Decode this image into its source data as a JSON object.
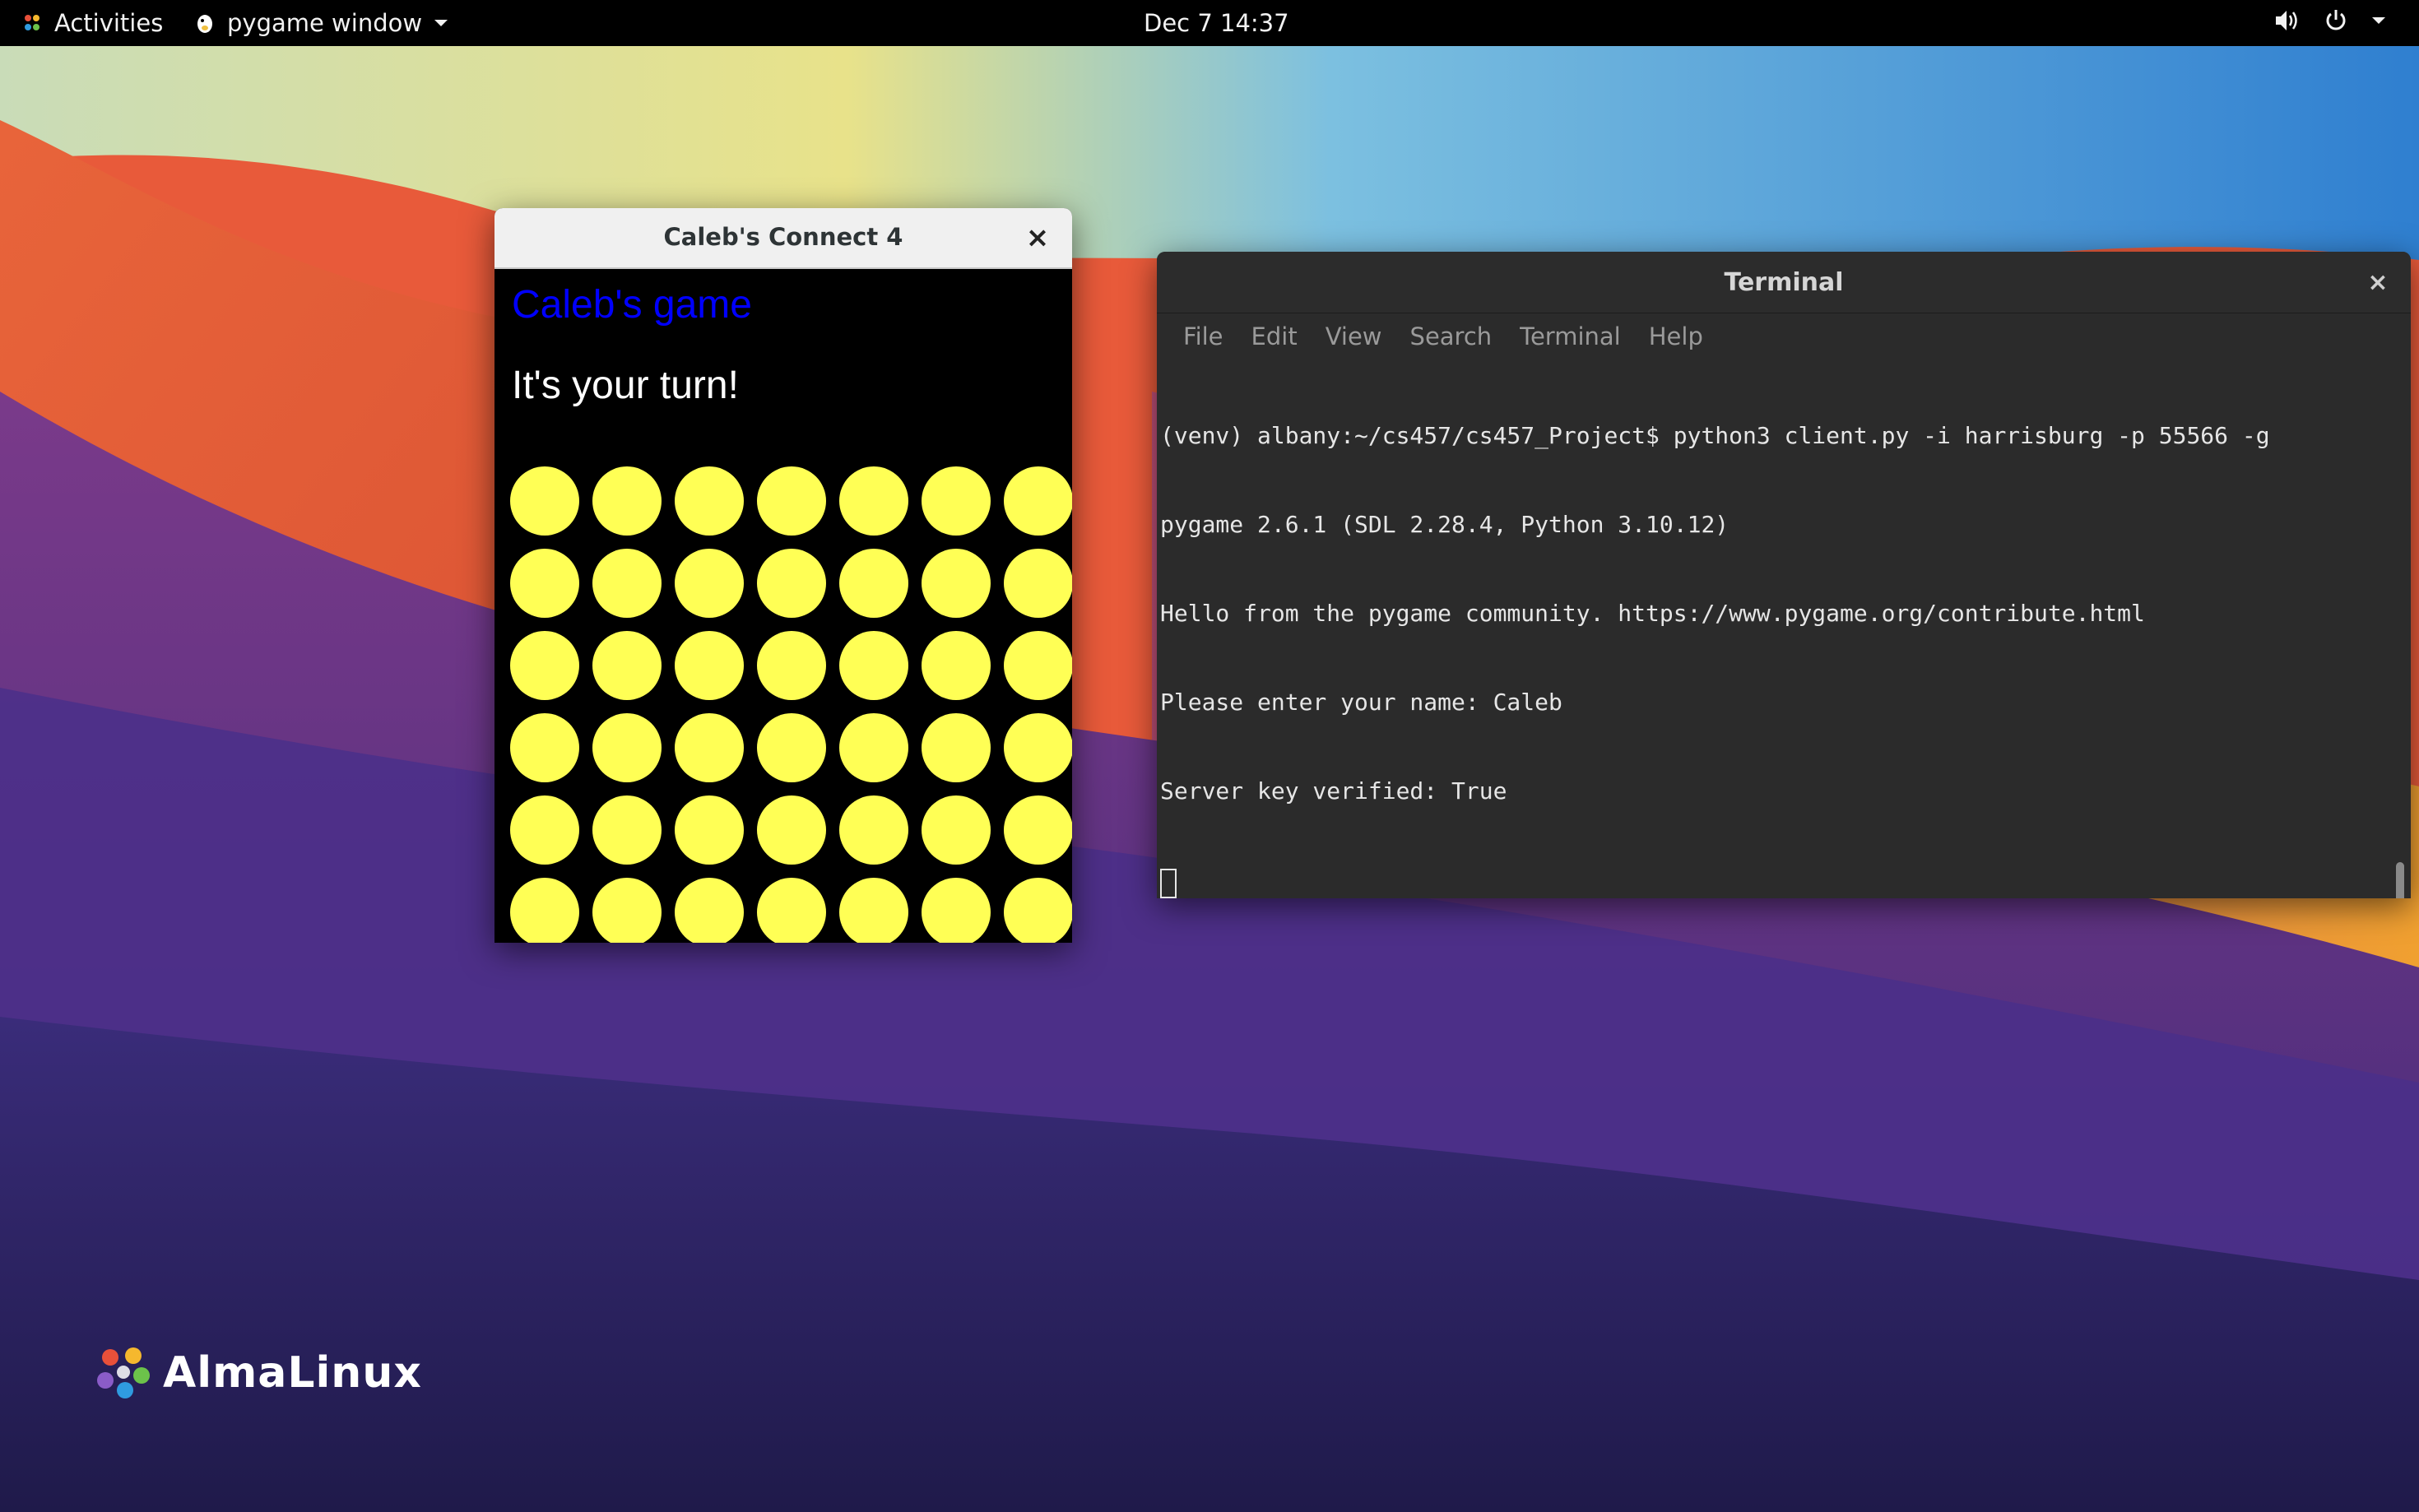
{
  "topbar": {
    "activities_label": "Activities",
    "app_menu_label": "pygame window",
    "clock": "Dec 7  14:37",
    "icons": [
      "alma-activities-icon",
      "pygame-icon",
      "chevron-down-icon",
      "volume-icon",
      "power-icon",
      "chevron-down-icon"
    ]
  },
  "game_window": {
    "title": "Caleb's Connect 4",
    "close_glyph": "×",
    "owner_text": "Caleb's game",
    "status_text": "It's your turn!",
    "owner_color": "#0000ff",
    "board": {
      "rows": 6,
      "columns": 7,
      "empty_cell_color": "#ffff55",
      "cells": [
        [
          "empty",
          "empty",
          "empty",
          "empty",
          "empty",
          "empty",
          "empty"
        ],
        [
          "empty",
          "empty",
          "empty",
          "empty",
          "empty",
          "empty",
          "empty"
        ],
        [
          "empty",
          "empty",
          "empty",
          "empty",
          "empty",
          "empty",
          "empty"
        ],
        [
          "empty",
          "empty",
          "empty",
          "empty",
          "empty",
          "empty",
          "empty"
        ],
        [
          "empty",
          "empty",
          "empty",
          "empty",
          "empty",
          "empty",
          "empty"
        ],
        [
          "empty",
          "empty",
          "empty",
          "empty",
          "empty",
          "empty",
          "empty"
        ]
      ]
    }
  },
  "terminal": {
    "title": "Terminal",
    "close_glyph": "×",
    "menu": [
      "File",
      "Edit",
      "View",
      "Search",
      "Terminal",
      "Help"
    ],
    "lines": [
      "(venv) albany:~/cs457/cs457_Project$ python3 client.py -i harrisburg -p 55566 -g",
      "pygame 2.6.1 (SDL 2.28.4, Python 3.10.12)",
      "Hello from the pygame community. https://www.pygame.org/contribute.html",
      "Please enter your name: Caleb",
      "Server key verified: True"
    ]
  },
  "desktop": {
    "logo_text": "AlmaLinux"
  }
}
